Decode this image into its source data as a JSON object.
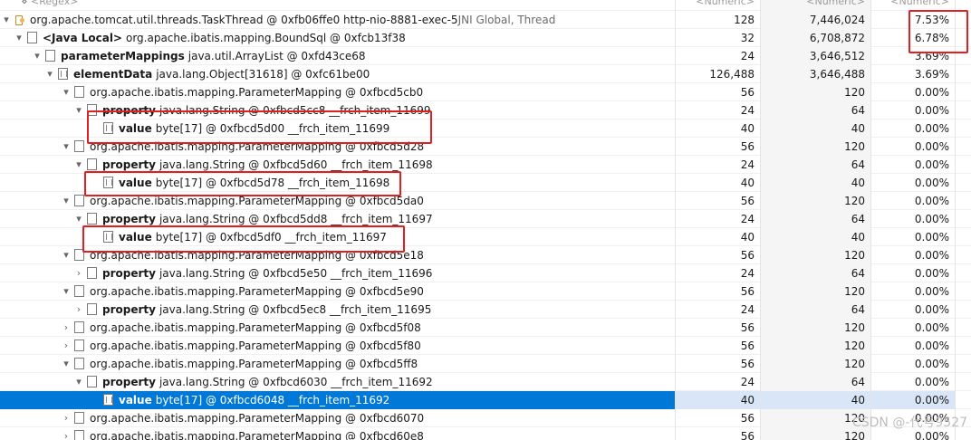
{
  "header": {
    "col1": "<Regex>",
    "col2": "<Numeric>",
    "col3": "<Numeric>",
    "col4": "<Numeric>"
  },
  "rows": [
    {
      "twisty": "▾",
      "icon": "thread",
      "kw": "",
      "text": "org.apache.tomcat.util.threads.TaskThread @ 0xfb06ffe0  http-nio-8881-exec-5",
      "extra": " JNI Global, Thread",
      "v1": "128",
      "v2": "7,446,024",
      "v3": "7.53%"
    },
    {
      "twisty": "▾",
      "icon": "doc",
      "kw": "<Java Local>",
      "text": "org.apache.ibatis.mapping.BoundSql @ 0xfcb13f38",
      "extra": "",
      "v1": "32",
      "v2": "6,708,872",
      "v3": "6.78%"
    },
    {
      "twisty": "▾",
      "icon": "doc",
      "kw": "parameterMappings",
      "text": "java.util.ArrayList @ 0xfd43ce68",
      "extra": "",
      "v1": "24",
      "v2": "3,646,512",
      "v3": "3.69%"
    },
    {
      "twisty": "▾",
      "icon": "arr",
      "kw": "elementData",
      "text": "java.lang.Object[31618] @ 0xfc61be00",
      "extra": "",
      "v1": "126,488",
      "v2": "3,646,488",
      "v3": "3.69%"
    },
    {
      "twisty": "▾",
      "icon": "doc",
      "kw": "",
      "text": "org.apache.ibatis.mapping.ParameterMapping @ 0xfbcd5cb0",
      "extra": "",
      "v1": "56",
      "v2": "120",
      "v3": "0.00%"
    },
    {
      "twisty": "▾",
      "icon": "doc",
      "kw": "property",
      "text": "java.lang.String @ 0xfbcd5cc8  __frch_item_11699",
      "extra": "",
      "v1": "24",
      "v2": "64",
      "v3": "0.00%"
    },
    {
      "twisty": "",
      "icon": "arr",
      "kw": "value",
      "text": "byte[17] @ 0xfbcd5d00  __frch_item_11699",
      "extra": "",
      "v1": "40",
      "v2": "40",
      "v3": "0.00%"
    },
    {
      "twisty": "▾",
      "icon": "doc",
      "kw": "",
      "text": "org.apache.ibatis.mapping.ParameterMapping @ 0xfbcd5d28",
      "extra": "",
      "v1": "56",
      "v2": "120",
      "v3": "0.00%"
    },
    {
      "twisty": "▾",
      "icon": "doc",
      "kw": "property",
      "text": "java.lang.String @ 0xfbcd5d60  __frch_item_11698",
      "extra": "",
      "v1": "24",
      "v2": "64",
      "v3": "0.00%"
    },
    {
      "twisty": "",
      "icon": "arr",
      "kw": "value",
      "text": "byte[17] @ 0xfbcd5d78  __frch_item_11698",
      "extra": "",
      "v1": "40",
      "v2": "40",
      "v3": "0.00%"
    },
    {
      "twisty": "▾",
      "icon": "doc",
      "kw": "",
      "text": "org.apache.ibatis.mapping.ParameterMapping @ 0xfbcd5da0",
      "extra": "",
      "v1": "56",
      "v2": "120",
      "v3": "0.00%"
    },
    {
      "twisty": "▾",
      "icon": "doc",
      "kw": "property",
      "text": "java.lang.String @ 0xfbcd5dd8  __frch_item_11697",
      "extra": "",
      "v1": "24",
      "v2": "64",
      "v3": "0.00%"
    },
    {
      "twisty": "",
      "icon": "arr",
      "kw": "value",
      "text": "byte[17] @ 0xfbcd5df0  __frch_item_11697",
      "extra": "",
      "v1": "40",
      "v2": "40",
      "v3": "0.00%"
    },
    {
      "twisty": "▾",
      "icon": "doc",
      "kw": "",
      "text": "org.apache.ibatis.mapping.ParameterMapping @ 0xfbcd5e18",
      "extra": "",
      "v1": "56",
      "v2": "120",
      "v3": "0.00%"
    },
    {
      "twisty": "›",
      "icon": "doc",
      "kw": "property",
      "text": "java.lang.String @ 0xfbcd5e50  __frch_item_11696",
      "extra": "",
      "v1": "24",
      "v2": "64",
      "v3": "0.00%"
    },
    {
      "twisty": "▾",
      "icon": "doc",
      "kw": "",
      "text": "org.apache.ibatis.mapping.ParameterMapping @ 0xfbcd5e90",
      "extra": "",
      "v1": "56",
      "v2": "120",
      "v3": "0.00%"
    },
    {
      "twisty": "›",
      "icon": "doc",
      "kw": "property",
      "text": "java.lang.String @ 0xfbcd5ec8  __frch_item_11695",
      "extra": "",
      "v1": "24",
      "v2": "64",
      "v3": "0.00%"
    },
    {
      "twisty": "›",
      "icon": "doc",
      "kw": "",
      "text": "org.apache.ibatis.mapping.ParameterMapping @ 0xfbcd5f08",
      "extra": "",
      "v1": "56",
      "v2": "120",
      "v3": "0.00%"
    },
    {
      "twisty": "›",
      "icon": "doc",
      "kw": "",
      "text": "org.apache.ibatis.mapping.ParameterMapping @ 0xfbcd5f80",
      "extra": "",
      "v1": "56",
      "v2": "120",
      "v3": "0.00%"
    },
    {
      "twisty": "▾",
      "icon": "doc",
      "kw": "",
      "text": "org.apache.ibatis.mapping.ParameterMapping @ 0xfbcd5ff8",
      "extra": "",
      "v1": "56",
      "v2": "120",
      "v3": "0.00%"
    },
    {
      "twisty": "▾",
      "icon": "doc",
      "kw": "property",
      "text": "java.lang.String @ 0xfbcd6030  __frch_item_11692",
      "extra": "",
      "v1": "24",
      "v2": "64",
      "v3": "0.00%"
    },
    {
      "twisty": "",
      "icon": "arr",
      "kw": "value",
      "text": "byte[17] @ 0xfbcd6048  __frch_item_11692",
      "extra": "",
      "v1": "40",
      "v2": "40",
      "v3": "0.00%",
      "selected": true
    },
    {
      "twisty": "›",
      "icon": "doc",
      "kw": "",
      "text": "org.apache.ibatis.mapping.ParameterMapping @ 0xfbcd6070",
      "extra": "",
      "v1": "56",
      "v2": "120",
      "v3": "0.00%"
    },
    {
      "twisty": "›",
      "icon": "doc",
      "kw": "",
      "text": "org.apache.ibatis.mapping.ParameterMapping @ 0xfbcd60e8",
      "extra": "",
      "v1": "56",
      "v2": "120",
      "v3": "0.00%"
    }
  ],
  "watermark": "CSDN @-代号9527",
  "colors": {
    "selection": "#0078d7",
    "highlight_box": "#e02020"
  }
}
